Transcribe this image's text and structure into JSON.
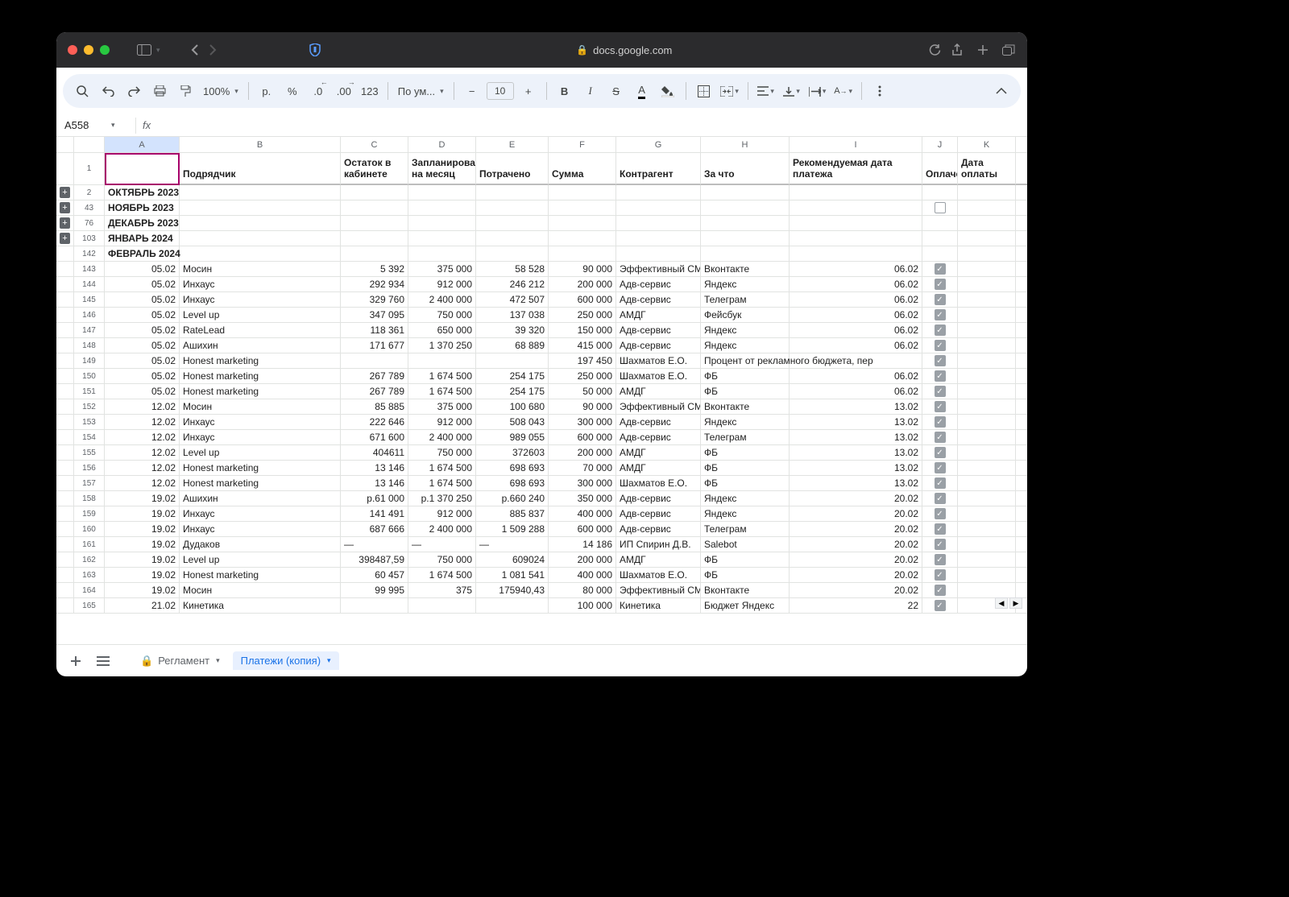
{
  "browser": {
    "url_host": "docs.google.com"
  },
  "toolbar": {
    "zoom": "100%",
    "currency_label": "р.",
    "percent_label": "%",
    "dec_dec": ".0",
    "dec_inc": ".00",
    "num_fmt": "123",
    "font_label": "По ум...",
    "font_size": "10"
  },
  "namebox": {
    "cell": "A558",
    "fx": "fx"
  },
  "columns": [
    "A",
    "B",
    "C",
    "D",
    "E",
    "F",
    "G",
    "H",
    "I",
    "J",
    "K"
  ],
  "headers": {
    "row": "1",
    "A": "",
    "B": "Подрядчик",
    "C": "Остаток в кабинете",
    "D": "Запланировано на месяц",
    "E": "Потрачено",
    "F": "Сумма",
    "G": "Контрагент",
    "H": "За что",
    "I": "Рекомендуемая дата платежа",
    "J": "Оплачено",
    "K": "Дата оплаты"
  },
  "months": [
    {
      "rownum": "2",
      "label": "ОКТЯБРЬ 2023",
      "expand": true,
      "check": null
    },
    {
      "rownum": "43",
      "label": "НОЯБРЬ 2023",
      "expand": true,
      "check": false
    },
    {
      "rownum": "76",
      "label": "ДЕКАБРЬ 2023",
      "expand": true,
      "check": null
    },
    {
      "rownum": "103",
      "label": "ЯНВАРЬ 2024",
      "expand": true,
      "check": null
    },
    {
      "rownum": "142",
      "label": "ФЕВРАЛЬ 2024",
      "expand": false,
      "check": null
    }
  ],
  "rows": [
    {
      "n": "143",
      "A": "05.02",
      "B": "Мосин",
      "C": "5 392",
      "D": "375 000",
      "E": "58 528",
      "F": "90 000",
      "G": "Эффективный СМ",
      "H": "Вконтакте",
      "I": "06.02",
      "J": true
    },
    {
      "n": "144",
      "A": "05.02",
      "B": "Инхаус",
      "C": "292 934",
      "D": "912 000",
      "E": "246 212",
      "F": "200 000",
      "G": "Адв-сервис",
      "H": "Яндекс",
      "I": "06.02",
      "J": true
    },
    {
      "n": "145",
      "A": "05.02",
      "B": "Инхаус",
      "C": "329 760",
      "D": "2 400 000",
      "E": "472 507",
      "F": "600 000",
      "G": "Адв-сервис",
      "H": "Телеграм",
      "I": "06.02",
      "J": true
    },
    {
      "n": "146",
      "A": "05.02",
      "B": "Level up",
      "C": "347 095",
      "D": "750 000",
      "E": "137 038",
      "F": "250 000",
      "G": "АМДГ",
      "H": "Фейсбук",
      "I": "06.02",
      "J": true
    },
    {
      "n": "147",
      "A": "05.02",
      "B": "RateLead",
      "C": "118 361",
      "D": "650 000",
      "E": "39 320",
      "F": "150 000",
      "G": "Адв-сервис",
      "H": "Яндекс",
      "I": "06.02",
      "J": true
    },
    {
      "n": "148",
      "A": "05.02",
      "B": "Ашихин",
      "C": "171 677",
      "D": "1 370 250",
      "E": "68 889",
      "F": "415 000",
      "G": "Адв-сервис",
      "H": "Яндекс",
      "I": "06.02",
      "J": true
    },
    {
      "n": "149",
      "A": "05.02",
      "B": "Honest marketing",
      "C": "",
      "D": "",
      "E": "",
      "F": "197 450",
      "G": "Шахматов Е.О.",
      "H": "Процент от рекламного бюджета, пер",
      "I": "",
      "J": true,
      "Hspan": true
    },
    {
      "n": "150",
      "A": "05.02",
      "B": "Honest marketing",
      "C": "267 789",
      "D": "1 674 500",
      "E": "254 175",
      "F": "250 000",
      "G": "Шахматов Е.О.",
      "H": "ФБ",
      "I": "06.02",
      "J": true
    },
    {
      "n": "151",
      "A": "05.02",
      "B": "Honest marketing",
      "C": "267 789",
      "D": "1 674 500",
      "E": "254 175",
      "F": "50 000",
      "G": "АМДГ",
      "H": "ФБ",
      "I": "06.02",
      "J": true
    },
    {
      "n": "152",
      "A": "12.02",
      "B": "Мосин",
      "C": "85 885",
      "D": "375 000",
      "E": "100 680",
      "F": "90 000",
      "G": "Эффективный СМ",
      "H": "Вконтакте",
      "I": "13.02",
      "J": true
    },
    {
      "n": "153",
      "A": "12.02",
      "B": "Инхаус",
      "C": "222 646",
      "D": "912 000",
      "E": "508 043",
      "F": "300 000",
      "G": "Адв-сервис",
      "H": "Яндекс",
      "I": "13.02",
      "J": true
    },
    {
      "n": "154",
      "A": "12.02",
      "B": "Инхаус",
      "C": "671 600",
      "D": "2 400 000",
      "E": "989 055",
      "F": "600 000",
      "G": "Адв-сервис",
      "H": "Телеграм",
      "I": "13.02",
      "J": true
    },
    {
      "n": "155",
      "A": "12.02",
      "B": "Level up",
      "C": "404611",
      "D": "750 000",
      "E": "372603",
      "F": "200 000",
      "G": "АМДГ",
      "H": "ФБ",
      "I": "13.02",
      "J": true
    },
    {
      "n": "156",
      "A": "12.02",
      "B": "Honest marketing",
      "C": "13 146",
      "D": "1 674 500",
      "E": "698 693",
      "F": "70 000",
      "G": "АМДГ",
      "H": "ФБ",
      "I": "13.02",
      "J": true
    },
    {
      "n": "157",
      "A": "12.02",
      "B": "Honest marketing",
      "C": "13 146",
      "D": "1 674 500",
      "E": "698 693",
      "F": "300 000",
      "G": "Шахматов Е.О.",
      "H": "ФБ",
      "I": "13.02",
      "J": true
    },
    {
      "n": "158",
      "A": "19.02",
      "B": "Ашихин",
      "C": "р.61 000",
      "D": "р.1 370 250",
      "E": "р.660 240",
      "F": "350 000",
      "G": "Адв-сервис",
      "H": "Яндекс",
      "I": "20.02",
      "J": true
    },
    {
      "n": "159",
      "A": "19.02",
      "B": "Инхаус",
      "C": "141 491",
      "D": "912 000",
      "E": "885 837",
      "F": "400 000",
      "G": "Адв-сервис",
      "H": "Яндекс",
      "I": "20.02",
      "J": true
    },
    {
      "n": "160",
      "A": "19.02",
      "B": "Инхаус",
      "C": "687 666",
      "D": "2 400 000",
      "E": "1 509 288",
      "F": "600 000",
      "G": "Адв-сервис",
      "H": "Телеграм",
      "I": "20.02",
      "J": true
    },
    {
      "n": "161",
      "A": "19.02",
      "B": "Дудаков",
      "C": "—",
      "D": "—",
      "E": "—",
      "F": "14 186",
      "G": "ИП Спирин Д.В.",
      "H": "Salebot",
      "I": "20.02",
      "J": true,
      "dash": true
    },
    {
      "n": "162",
      "A": "19.02",
      "B": "Level up",
      "C": "398487,59",
      "D": "750 000",
      "E": "609024",
      "F": "200 000",
      "G": "АМДГ",
      "H": "ФБ",
      "I": "20.02",
      "J": true
    },
    {
      "n": "163",
      "A": "19.02",
      "B": "Honest marketing",
      "C": "60 457",
      "D": "1 674 500",
      "E": "1 081 541",
      "F": "400 000",
      "G": "Шахматов Е.О.",
      "H": "ФБ",
      "I": "20.02",
      "J": true
    },
    {
      "n": "164",
      "A": "19.02",
      "B": "Мосин",
      "C": "99 995",
      "D": "375",
      "E": "175940,43",
      "F": "80 000",
      "G": "Эффективный СМ",
      "H": "Вконтакте",
      "I": "20.02",
      "J": true
    },
    {
      "n": "165",
      "A": "21.02",
      "B": "Кинетика",
      "C": "",
      "D": "",
      "E": "",
      "F": "100 000",
      "G": "Кинетика",
      "H": "Бюджет Яндекс",
      "I": "22",
      "J": true
    }
  ],
  "tabs": {
    "locked": "Регламент",
    "active": "Платежи (копия)"
  }
}
